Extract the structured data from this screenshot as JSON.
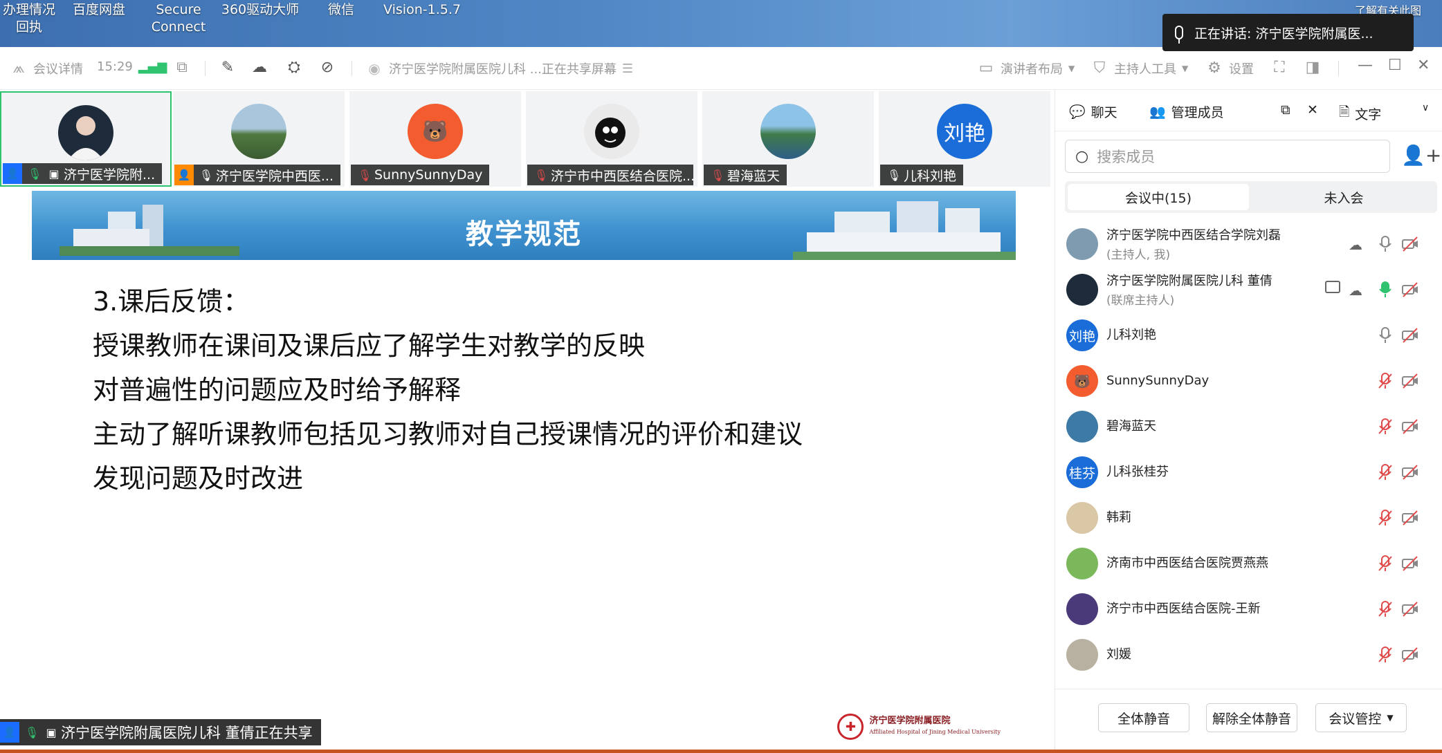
{
  "desktop": {
    "icons": [
      {
        "label": "办理情况\n回执"
      },
      {
        "label": "百度网盘"
      },
      {
        "label": "Secure\nConnect"
      },
      {
        "label": "360驱动大师"
      },
      {
        "label": "微信"
      },
      {
        "label": "Vision-1.5.7"
      }
    ],
    "corner_text": "了解有关此图"
  },
  "speaking": {
    "label": "正在讲话:",
    "name": "济宁医学院附属医..."
  },
  "toolbar": {
    "meeting_details": "会议详情",
    "time": "15:29",
    "title": "济宁医学院附属医院儿科 ...正在共享屏幕",
    "presenter_layout": "演讲者布局",
    "host_tools": "主持人工具",
    "settings": "设置"
  },
  "tiles": [
    {
      "name": "济宁医学院附...",
      "avatar_text": "",
      "avatar_color": "#1d2b3b",
      "active": true
    },
    {
      "name": "济宁医学院中西医...",
      "avatar_text": "",
      "avatar_color": "#6e93a8"
    },
    {
      "name": "SunnySunnyDay",
      "avatar_text": "🐻",
      "avatar_color": "#f25c2e"
    },
    {
      "name": "济宁市中西医结合医院...",
      "avatar_text": "",
      "avatar_color": "#eaeaea"
    },
    {
      "name": "碧海蓝天",
      "avatar_text": "",
      "avatar_color": "#3d7aa6"
    },
    {
      "name": "儿科刘艳",
      "avatar_text": "刘艳",
      "avatar_color": "#1a6dd8"
    }
  ],
  "slide": {
    "title": "教学规范",
    "lines": [
      "3.课后反馈：",
      "授课教师在课间及课后应了解学生对教学的反映",
      "对普遍性的问题应及时给予解释",
      "主动了解听课教师包括见习教师对自己授课情况的评价和建议",
      "发现问题及时改进"
    ],
    "logo_cn": "济宁医学院附属医院",
    "logo_en": "Affiliated Hospital of Jining Medical University"
  },
  "share_status": "济宁医学院附属医院儿科 董倩正在共享",
  "panel": {
    "tab_chat": "聊天",
    "tab_members": "管理成员",
    "tab_text": "文字",
    "search_placeholder": "搜索成员",
    "seg_in": "会议中(15)",
    "seg_out": "未入会",
    "members": [
      {
        "name": "济宁医学院中西医结合学院刘磊",
        "role": "(主持人, 我)",
        "avatar_text": "",
        "avatar_color": "#7e9bb0",
        "mic": "on",
        "cloud": true
      },
      {
        "name": "济宁医学院附属医院儿科 董倩",
        "role": "(联席主持人)",
        "avatar_text": "",
        "avatar_color": "#1d2b3b",
        "mic": "speaking",
        "cloud": true,
        "sharing": true
      },
      {
        "name": "儿科刘艳",
        "role": "",
        "avatar_text": "刘艳",
        "avatar_color": "#1a6dd8",
        "mic": "on"
      },
      {
        "name": "SunnySunnyDay",
        "role": "",
        "avatar_text": "🐻",
        "avatar_color": "#f25c2e",
        "mic": "muted"
      },
      {
        "name": "碧海蓝天",
        "role": "",
        "avatar_text": "",
        "avatar_color": "#3d7aa6",
        "mic": "muted"
      },
      {
        "name": "儿科张桂芬",
        "role": "",
        "avatar_text": "桂芬",
        "avatar_color": "#1a6dd8",
        "mic": "muted"
      },
      {
        "name": "韩莉",
        "role": "",
        "avatar_text": "",
        "avatar_color": "#d9c7a6",
        "mic": "muted"
      },
      {
        "name": "济南市中西医结合医院贾燕燕",
        "role": "",
        "avatar_text": "",
        "avatar_color": "#7bb85c",
        "mic": "muted"
      },
      {
        "name": "济宁市中西医结合医院-王新",
        "role": "",
        "avatar_text": "",
        "avatar_color": "#4b3a7a",
        "mic": "muted"
      },
      {
        "name": "刘媛",
        "role": "",
        "avatar_text": "",
        "avatar_color": "#b8b0a0",
        "mic": "muted"
      }
    ],
    "btn_mute_all": "全体静音",
    "btn_unmute_all": "解除全体静音",
    "btn_control": "会议管控"
  },
  "colors": {
    "accent": "#1a6dff",
    "active_border": "#2fc36f",
    "mute_red": "#e04b4b",
    "speaking_green": "#2fc36f"
  }
}
